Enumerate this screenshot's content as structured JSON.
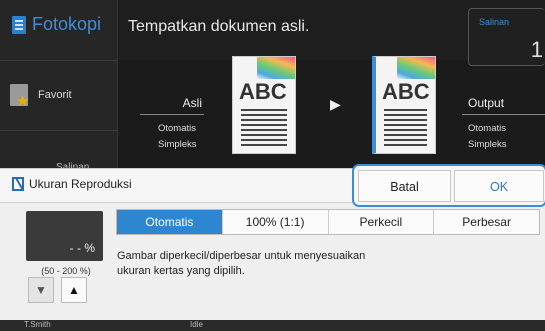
{
  "app": {
    "title": "Fotokopi",
    "instruction": "Tempatkan dokumen asli."
  },
  "sidebar": {
    "favorite_label": "Favorit",
    "peek_label": "Salinan"
  },
  "copies": {
    "label": "Salinan",
    "value": "1"
  },
  "original": {
    "label": "Asli",
    "line1": "Otomatis",
    "line2": "Simpleks",
    "page_text": "ABC"
  },
  "output": {
    "label": "Output",
    "line1": "Otomatis",
    "line2": "Simpleks",
    "page_text": "ABC"
  },
  "dialog": {
    "title": "Ukuran Reproduksi",
    "cancel_label": "Batal",
    "ok_label": "OK",
    "percent_value": "- - %",
    "range": "(50 - 200 %)",
    "tabs": [
      "Otomatis",
      "100% (1:1)",
      "Perkecil",
      "Perbesar"
    ],
    "active_tab": "Otomatis",
    "description": "Gambar diperkecil/diperbesar untuk menyesuaikan ukuran kertas yang dipilih."
  },
  "statusbar": {
    "user": "T.Smith",
    "status": "Idle"
  },
  "colors": {
    "accent": "#2f86d0",
    "brand_text": "#3f8fd6",
    "dark_bg": "#1b1b1b"
  }
}
